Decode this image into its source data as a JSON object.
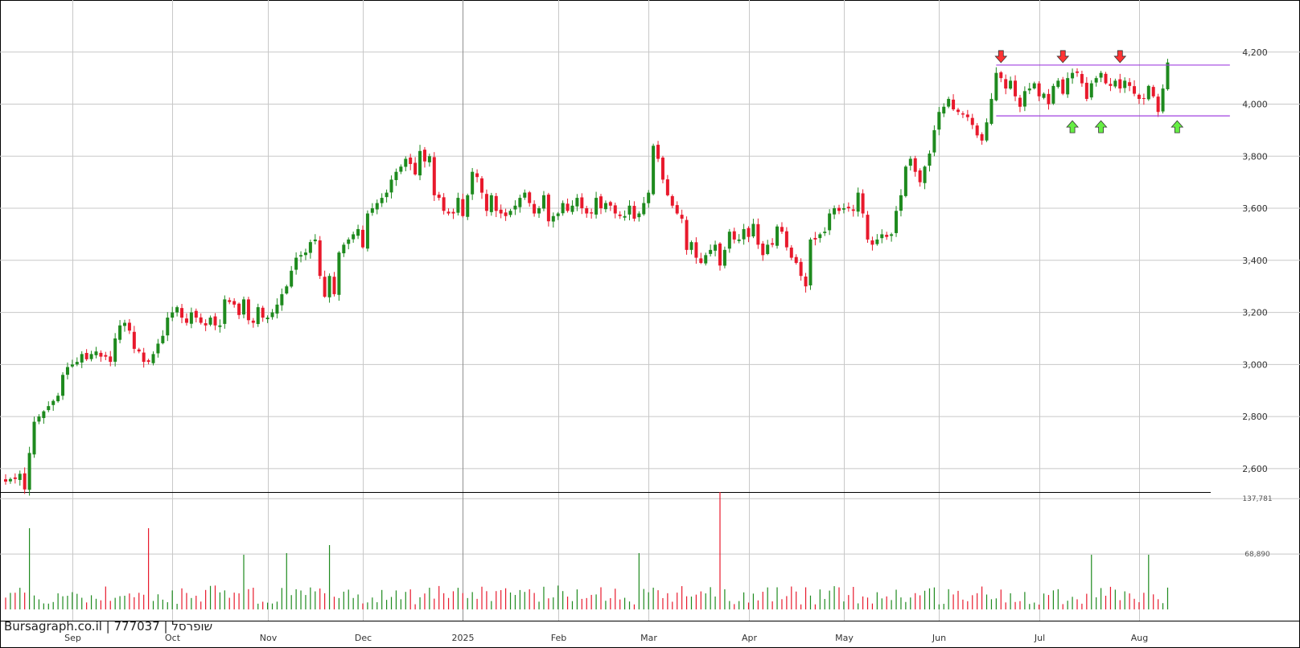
{
  "watermark": "Bursagraph.co.il | 777037 | שופרסל",
  "colors": {
    "up": "#1e8a1e",
    "down": "#e8192c",
    "grid": "#c8c8c8",
    "channel": "#a040e0",
    "arrow_up": "#66ee44",
    "arrow_down": "#ff3333"
  },
  "chart_data": {
    "type": "candlestick",
    "price_axis": {
      "ticks": [
        2600,
        2800,
        3000,
        3200,
        3400,
        3600,
        3800,
        4000,
        4200
      ],
      "labels": [
        "2,600",
        "2,800",
        "3,000",
        "3,200",
        "3,400",
        "3,600",
        "3,800",
        "4,000",
        "4,200"
      ],
      "range": [
        2510,
        4400
      ]
    },
    "volume_axis": {
      "ticks": [
        68890,
        137781
      ],
      "labels": [
        "68,890",
        "137,781"
      ],
      "range": [
        0,
        146000
      ]
    },
    "x_labels": [
      "Sep",
      "Oct",
      "Nov",
      "Dec",
      "2025",
      "Feb",
      "Mar",
      "Apr",
      "May",
      "Jun",
      "Jul",
      "Aug"
    ],
    "x_label_index": [
      14,
      35,
      55,
      75,
      96,
      116,
      135,
      156,
      176,
      196,
      217,
      238
    ],
    "channel": {
      "upper": 4150,
      "lower": 3955,
      "start_index": 208,
      "end_index": 252
    },
    "markers": [
      {
        "type": "sell",
        "index": 209,
        "price": 4150
      },
      {
        "type": "sell",
        "index": 222,
        "price": 4150
      },
      {
        "type": "sell",
        "index": 234,
        "price": 4150
      },
      {
        "type": "buy",
        "index": 224,
        "price": 3955
      },
      {
        "type": "buy",
        "index": 230,
        "price": 3955
      },
      {
        "type": "buy",
        "index": 246,
        "price": 3955
      }
    ],
    "close": [
      2550,
      2560,
      2560,
      2580,
      2520,
      2660,
      2780,
      2800,
      2820,
      2840,
      2860,
      2880,
      2960,
      2990,
      3000,
      3010,
      3040,
      3020,
      3040,
      3050,
      3030,
      3030,
      3010,
      3100,
      3150,
      3160,
      3130,
      3060,
      3050,
      3010,
      3010,
      3040,
      3080,
      3110,
      3180,
      3200,
      3220,
      3180,
      3160,
      3200,
      3180,
      3160,
      3150,
      3180,
      3150,
      3150,
      3250,
      3240,
      3230,
      3190,
      3250,
      3170,
      3160,
      3220,
      3180,
      3180,
      3200,
      3230,
      3270,
      3300,
      3360,
      3410,
      3420,
      3430,
      3470,
      3480,
      3340,
      3260,
      3340,
      3270,
      3430,
      3460,
      3480,
      3500,
      3520,
      3450,
      3580,
      3600,
      3620,
      3640,
      3660,
      3710,
      3740,
      3760,
      3790,
      3770,
      3730,
      3820,
      3780,
      3800,
      3650,
      3640,
      3590,
      3580,
      3580,
      3640,
      3570,
      3650,
      3740,
      3720,
      3660,
      3590,
      3650,
      3590,
      3580,
      3570,
      3590,
      3610,
      3640,
      3660,
      3620,
      3580,
      3600,
      3650,
      3550,
      3570,
      3580,
      3620,
      3590,
      3610,
      3640,
      3600,
      3580,
      3580,
      3640,
      3600,
      3620,
      3610,
      3580,
      3570,
      3570,
      3610,
      3560,
      3580,
      3620,
      3660,
      3840,
      3790,
      3710,
      3650,
      3610,
      3580,
      3560,
      3440,
      3470,
      3410,
      3390,
      3420,
      3440,
      3460,
      3380,
      3440,
      3510,
      3480,
      3480,
      3520,
      3490,
      3540,
      3460,
      3420,
      3460,
      3460,
      3530,
      3510,
      3450,
      3410,
      3390,
      3340,
      3300,
      3480,
      3480,
      3500,
      3510,
      3580,
      3600,
      3590,
      3600,
      3600,
      3590,
      3660,
      3580,
      3480,
      3460,
      3480,
      3500,
      3490,
      3500,
      3590,
      3650,
      3760,
      3790,
      3740,
      3700,
      3760,
      3810,
      3900,
      3970,
      3990,
      4020,
      3980,
      3970,
      3960,
      3950,
      3920,
      3880,
      3860,
      3930,
      4020,
      4120,
      4100,
      4060,
      4090,
      4030,
      3990,
      4050,
      4060,
      4080,
      4030,
      4040,
      4000,
      4070,
      4090,
      4040,
      4100,
      4120,
      4120,
      4080,
      4020,
      4080,
      4100,
      4120,
      4080,
      4070,
      4090,
      4060,
      4090,
      4070,
      4040,
      4020,
      4020,
      4070,
      4030,
      3970,
      4060,
      4160
    ]
  }
}
